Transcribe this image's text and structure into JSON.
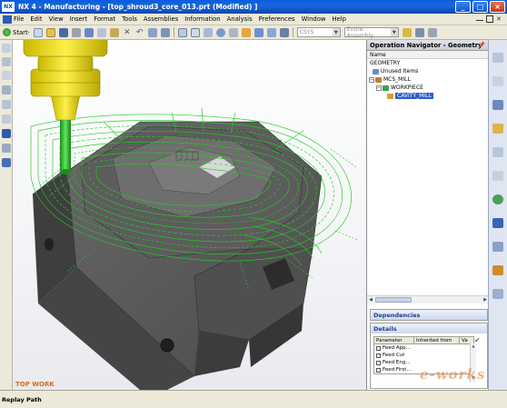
{
  "window": {
    "app_abbr": "NX",
    "title": "NX 4 - Manufacturing - [top_shroud3_core_013.prt (Modified) ]",
    "minimize": "_",
    "maximize": "□",
    "close": "×"
  },
  "menu": {
    "items": [
      "File",
      "Edit",
      "View",
      "Insert",
      "Format",
      "Tools",
      "Assemblies",
      "Information",
      "Analysis",
      "Preferences",
      "Window",
      "Help"
    ]
  },
  "toolbar": {
    "start_label": "Start·",
    "csys_combo": "CSYS",
    "assembly_combo": "Entire Assembly"
  },
  "viewport": {
    "view_label": "TOP WORK"
  },
  "navigator": {
    "title": "Operation Navigator - Geometry",
    "column_name": "Name",
    "tree": [
      {
        "label": "GEOMETRY",
        "level": 0,
        "icon": "none"
      },
      {
        "label": "Unused Items",
        "level": 1,
        "icon": "folder-icon"
      },
      {
        "label": "MCS_MILL",
        "level": 1,
        "icon": "csys-icon",
        "expander": "⊟"
      },
      {
        "label": "WORKPIECE",
        "level": 2,
        "icon": "workpiece-icon",
        "expander": "⊟"
      },
      {
        "label": "CAVITY_MILL",
        "level": 3,
        "icon": "operation-icon",
        "selected": true
      }
    ],
    "dependencies_title": "Dependencies",
    "details_title": "Details",
    "details_columns": [
      "Parameter",
      "Inherited from",
      "Va"
    ],
    "details_rows": [
      "Feed App...",
      "Feed Cut",
      "Feed Eng...",
      "Feed First..."
    ]
  },
  "status": {
    "text": "Replay Path"
  },
  "watermark": "e-works",
  "colors": {
    "title_bar": "#0a5de0",
    "toolpath": "#22cc22",
    "tool_holder": "#e8d800",
    "part": "#5a5a5a",
    "selection": "#2d5fc7"
  }
}
